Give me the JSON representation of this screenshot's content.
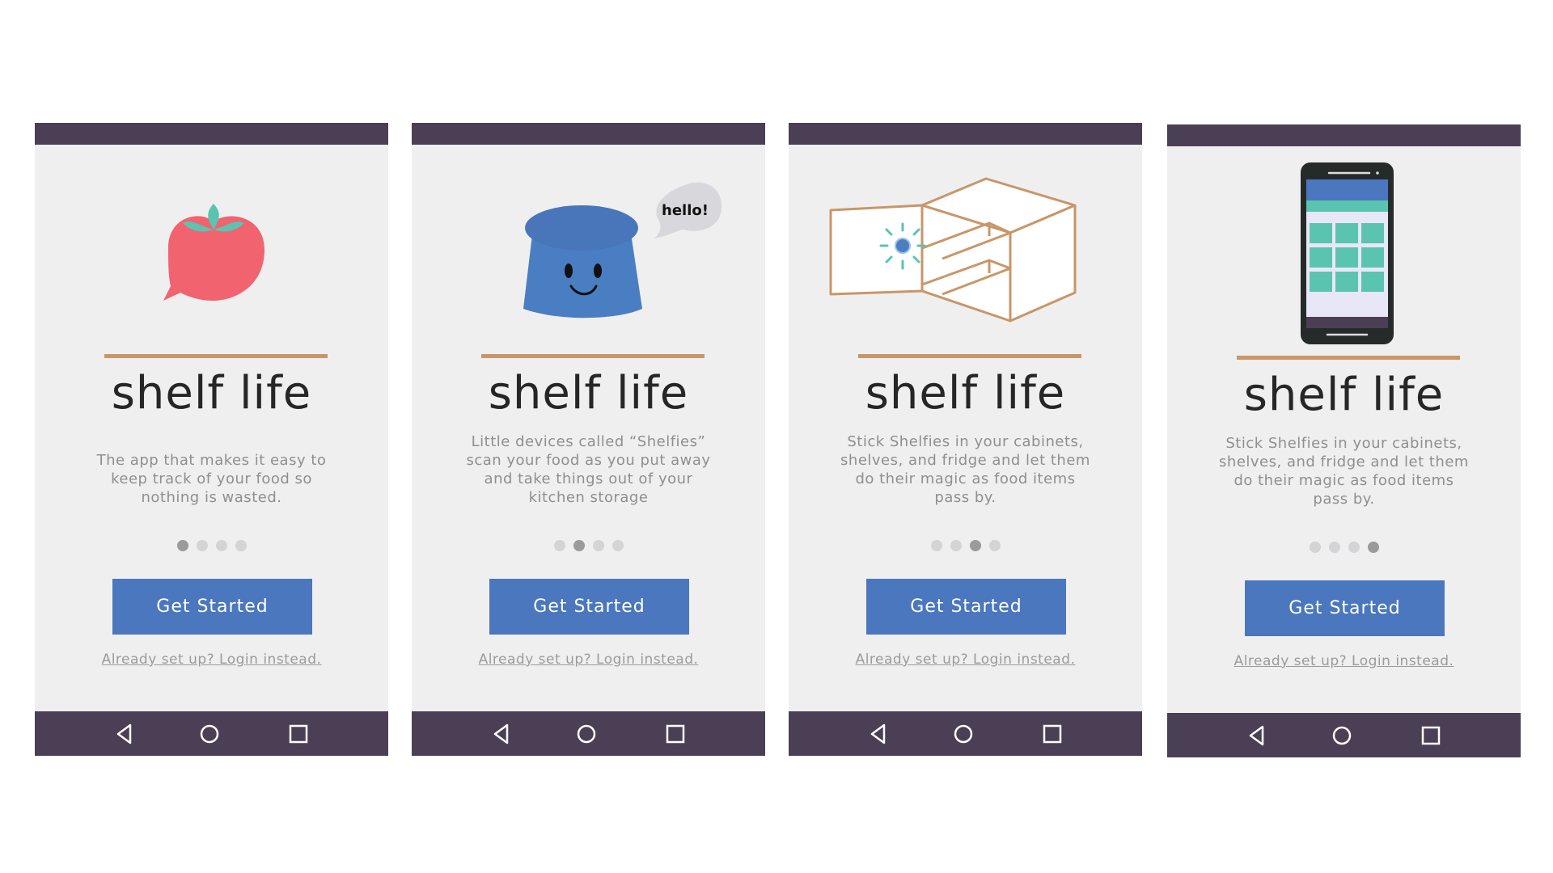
{
  "colors": {
    "bar": "#4a3f55",
    "screen_bg": "#efeff0",
    "accent_line": "#c99669",
    "button": "#4a77be",
    "tomato": "#f1636f",
    "leaf": "#5bc4b0",
    "shelfie_blue": "#4a7ec2"
  },
  "screens": [
    {
      "title": "shelf life",
      "description": "The app that makes it easy to keep track of your food so nothing is wasted.",
      "illustration": "tomato-speech-icon",
      "active_dot": 1,
      "button_label": "Get Started",
      "login_label": "Already set up? Login instead."
    },
    {
      "title": "shelf life",
      "description": "Little devices called “Shelfies” scan your food as you put away and take things out of your kitchen storage",
      "illustration": "shelfie-device-icon",
      "bubble_text": "hello!",
      "active_dot": 2,
      "button_label": "Get Started",
      "login_label": "Already set up? Login instead."
    },
    {
      "title": "shelf life",
      "description": "Stick Shelfies in your cabinets, shelves, and fridge and let them do their magic as food items pass by.",
      "illustration": "cabinet-icon",
      "active_dot": 3,
      "button_label": "Get Started",
      "login_label": "Already set up? Login instead."
    },
    {
      "title": "shelf life",
      "description": "Stick Shelfies in your cabinets, shelves, and fridge and let them do their magic as food items pass by.",
      "illustration": "smartphone-icon",
      "active_dot": 4,
      "button_label": "Get Started",
      "login_label": "Already set up? Login instead."
    }
  ],
  "nav_icons": [
    "back-icon",
    "home-icon",
    "recent-apps-icon"
  ]
}
